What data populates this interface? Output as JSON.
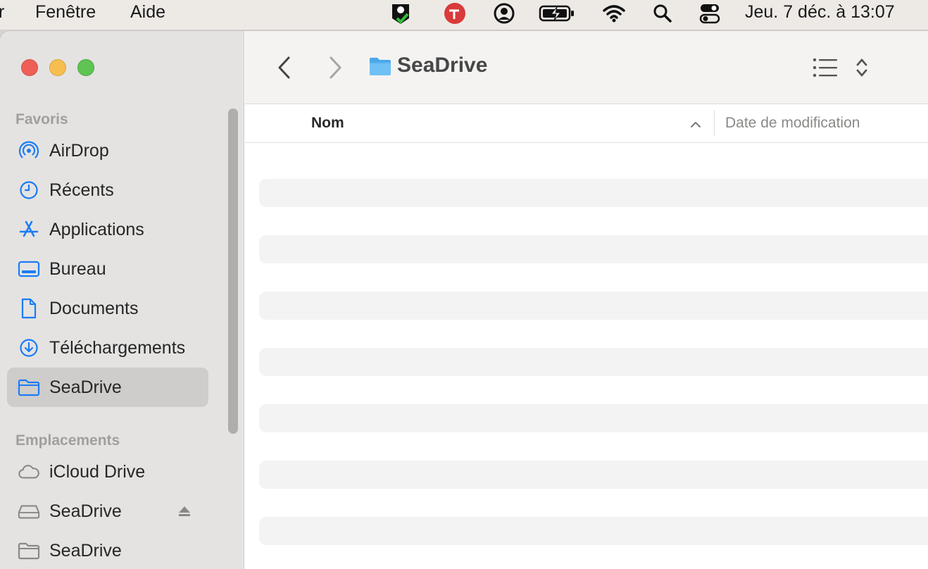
{
  "menubar": {
    "items": [
      "r",
      "Fenêtre",
      "Aide"
    ],
    "status_icons": [
      "seadrive-status-icon",
      "trend-micro-icon",
      "user-account-icon",
      "battery-charging-icon",
      "wifi-icon",
      "spotlight-search-icon",
      "control-center-icon"
    ],
    "clock": "Jeu. 7 déc. à 13:07"
  },
  "window": {
    "title": "SeaDrive",
    "sidebar": {
      "favorites_header": "Favoris",
      "favorites": [
        {
          "label": "AirDrop",
          "icon": "airdrop-icon"
        },
        {
          "label": "Récents",
          "icon": "clock-icon"
        },
        {
          "label": "Applications",
          "icon": "applications-icon"
        },
        {
          "label": "Bureau",
          "icon": "desktop-icon"
        },
        {
          "label": "Documents",
          "icon": "document-icon"
        },
        {
          "label": "Téléchargements",
          "icon": "download-icon"
        },
        {
          "label": "SeaDrive",
          "icon": "folder-icon",
          "selected": true
        }
      ],
      "locations_header": "Emplacements",
      "locations": [
        {
          "label": "iCloud Drive",
          "icon": "cloud-icon"
        },
        {
          "label": "SeaDrive",
          "icon": "drive-icon",
          "ejectable": true
        },
        {
          "label": "SeaDrive",
          "icon": "folder-icon"
        }
      ]
    },
    "columns": {
      "name": "Nom",
      "date_modified": "Date de modification"
    },
    "accent_color": "#1a7cf5"
  }
}
